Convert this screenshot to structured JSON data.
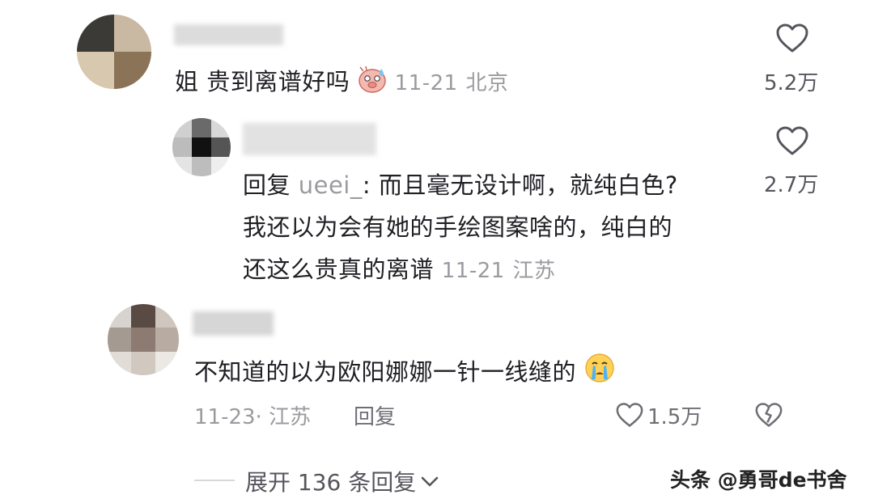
{
  "comments": [
    {
      "text": "姐 贵到离谱好吗",
      "emoji_icon": "pig-sweat-emoji-icon",
      "time": "11-21",
      "location": "北京",
      "likes": "5.2万"
    },
    {
      "reply_prefix": "回复",
      "reply_to": "ueei_",
      "line1": ": 而且毫无设计啊，就纯白色?",
      "line2": "我还以为会有她的手绘图案啥的，纯白的",
      "line3": "还这么贵真的离谱",
      "time": "11-21",
      "location": "江苏",
      "likes": "2.7万"
    },
    {
      "text": "不知道的以为欧阳娜娜一针一线缝的",
      "emoji_icon": "crying-face-emoji-icon",
      "time_location": "11-23· 江苏",
      "reply_label": "回复",
      "likes": "1.5万"
    }
  ],
  "expand": {
    "label": "展开 136 条回复"
  },
  "watermark": "头条 @勇哥de书舍",
  "colors": {
    "text": "#1f1f24",
    "meta": "#9a9ba0",
    "icon": "#55565c"
  }
}
